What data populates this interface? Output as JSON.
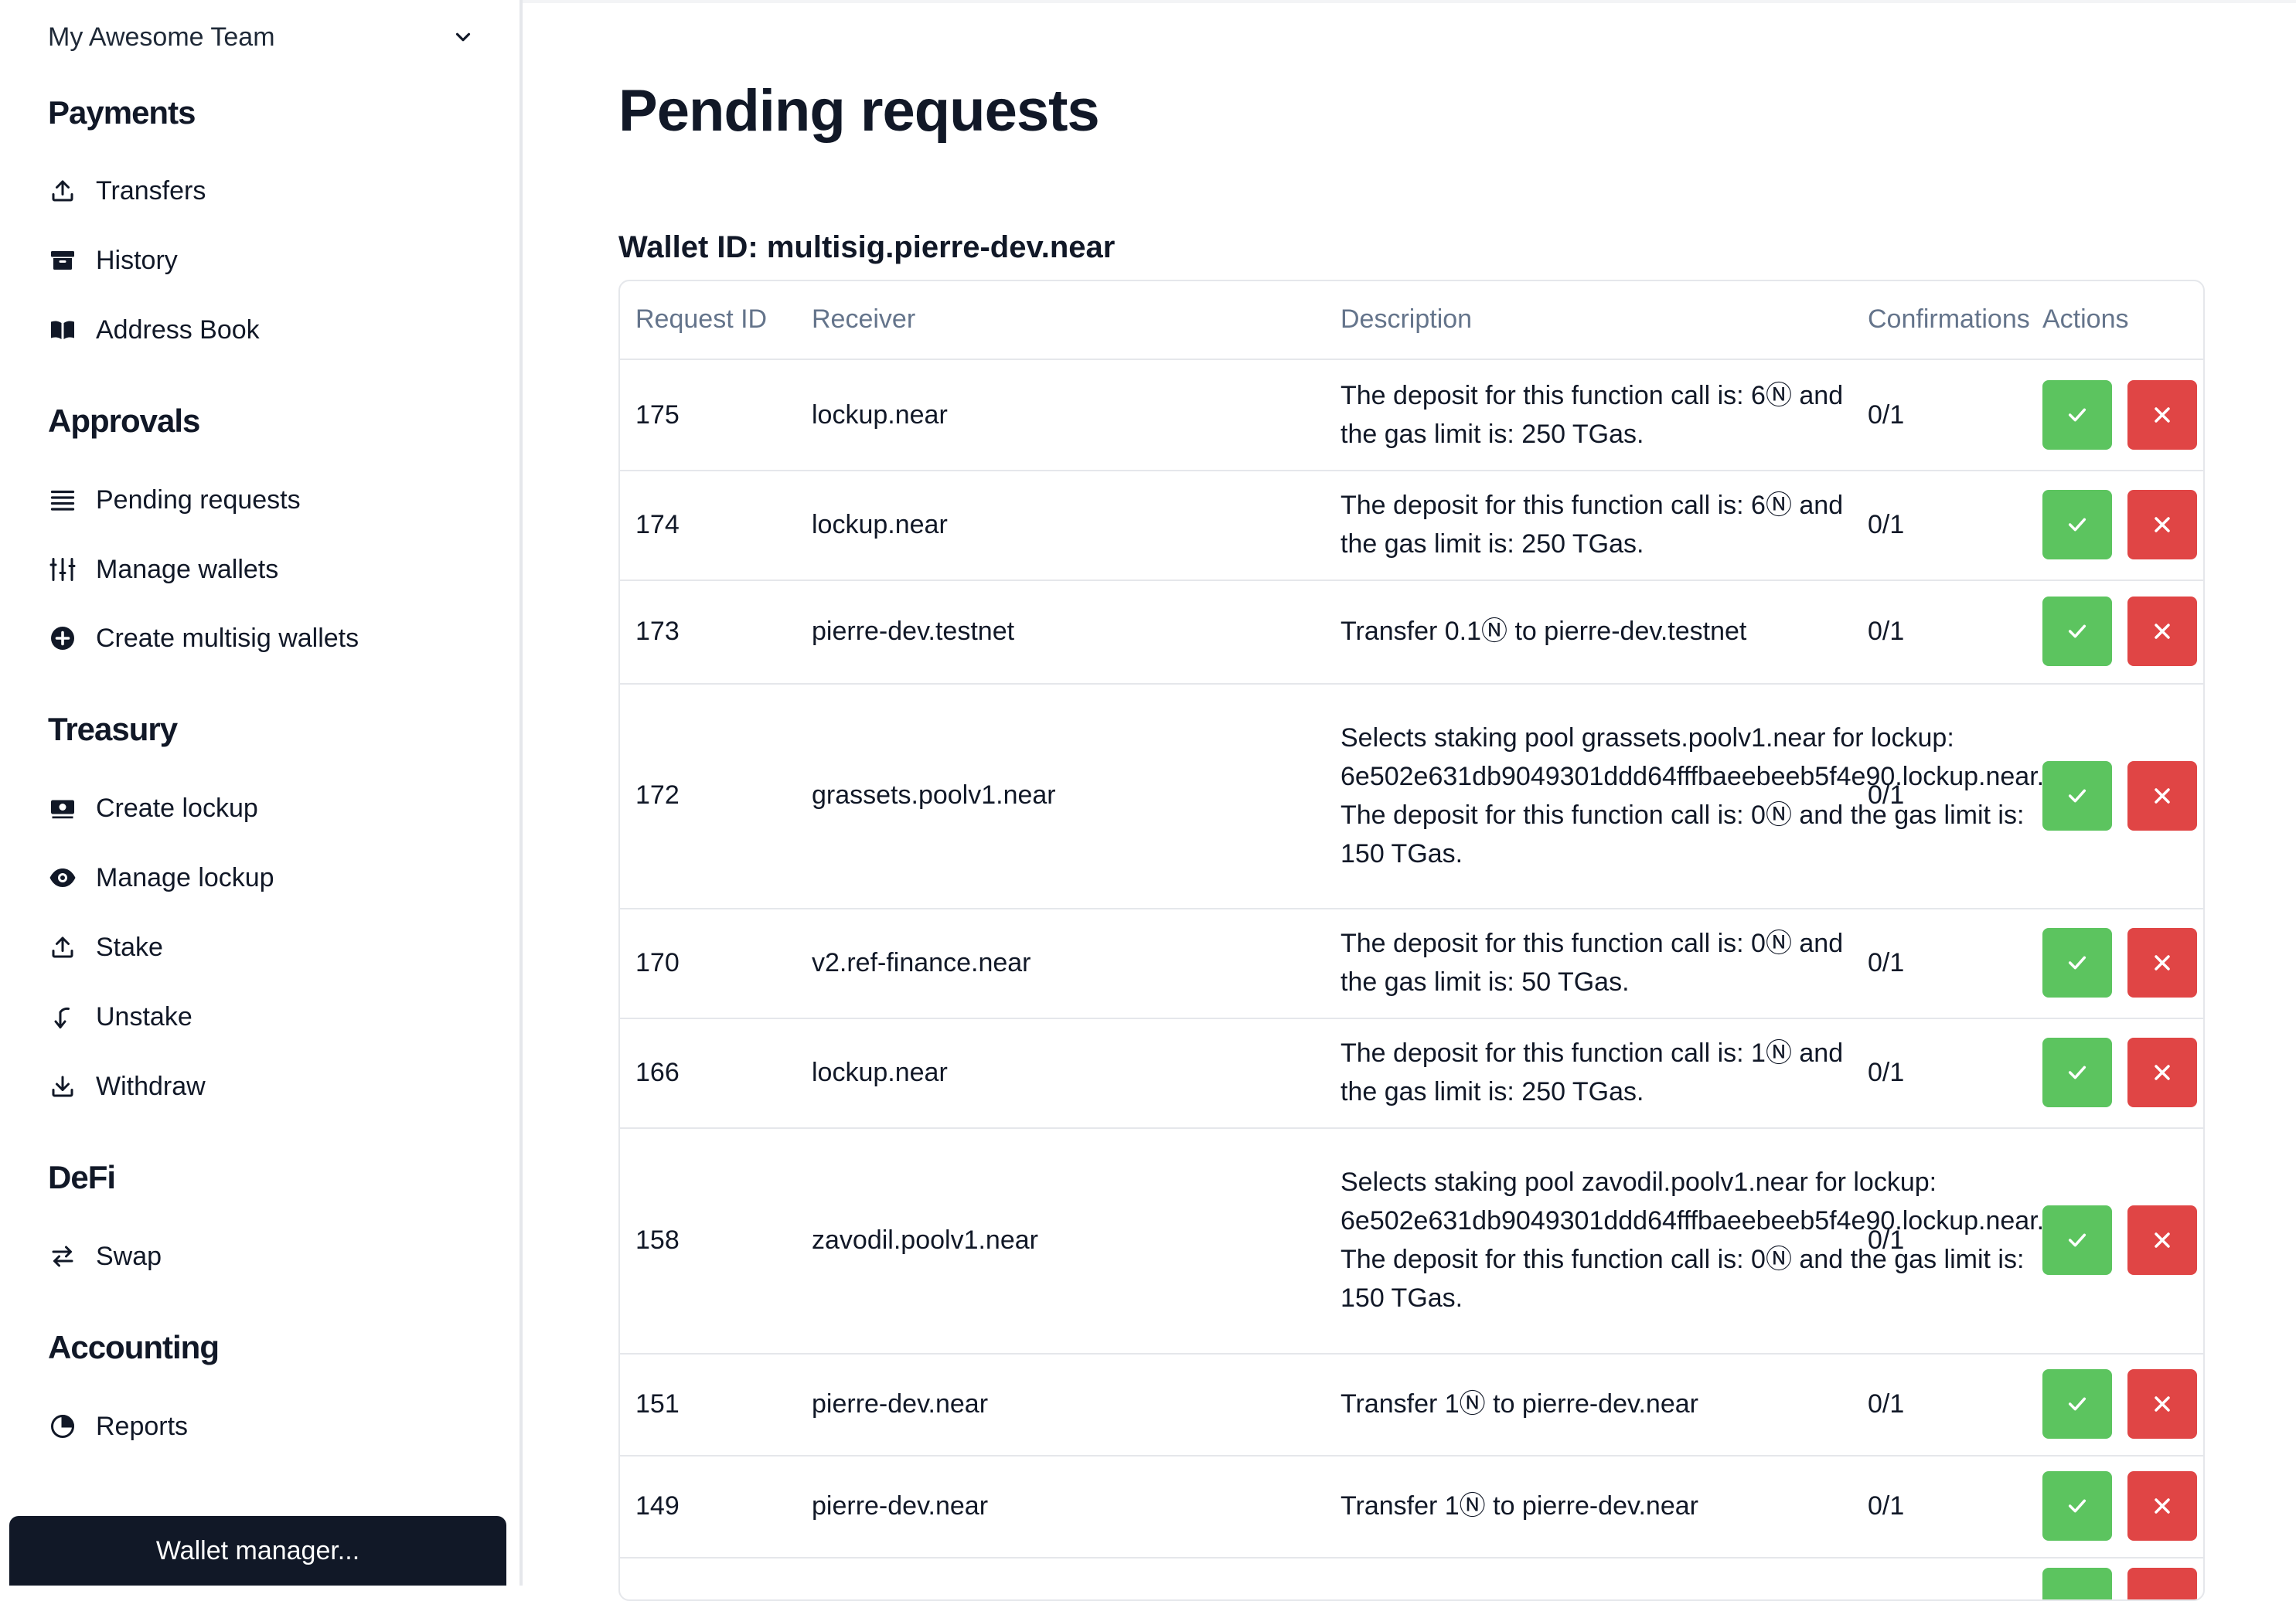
{
  "sidebar": {
    "team": "My Awesome Team",
    "sections": {
      "payments": {
        "title": "Payments",
        "items": [
          {
            "label": "Transfers",
            "icon": "upload-icon"
          },
          {
            "label": "History",
            "icon": "archive-icon"
          },
          {
            "label": "Address Book",
            "icon": "book-icon"
          }
        ]
      },
      "approvals": {
        "title": "Approvals",
        "items": [
          {
            "label": "Pending requests",
            "icon": "list-icon"
          },
          {
            "label": "Manage wallets",
            "icon": "sliders-icon"
          },
          {
            "label": "Create multisig wallets",
            "icon": "plus-circle-icon"
          }
        ]
      },
      "treasury": {
        "title": "Treasury",
        "items": [
          {
            "label": "Create lockup",
            "icon": "cash-icon"
          },
          {
            "label": "Manage lockup",
            "icon": "eye-icon"
          },
          {
            "label": "Stake",
            "icon": "upload-icon"
          },
          {
            "label": "Unstake",
            "icon": "unstake-icon"
          },
          {
            "label": "Withdraw",
            "icon": "download-icon"
          }
        ]
      },
      "defi": {
        "title": "DeFi",
        "items": [
          {
            "label": "Swap",
            "icon": "swap-icon"
          }
        ]
      },
      "accounting": {
        "title": "Accounting",
        "items": [
          {
            "label": "Reports",
            "icon": "pie-chart-icon"
          }
        ]
      }
    },
    "wallet_manager": "Wallet manager..."
  },
  "main": {
    "title": "Pending requests",
    "wallet_id": "Wallet ID: multisig.pierre-dev.near",
    "columns": {
      "request_id": "Request ID",
      "receiver": "Receiver",
      "description": "Description",
      "confirmations": "Confirmations",
      "actions": "Actions"
    },
    "rows": [
      {
        "id": "175",
        "receiver": "lockup.near",
        "description": "The deposit for this function call is: 6Ⓝ and the gas limit is: 250 TGas.",
        "confirmations": "0/1"
      },
      {
        "id": "174",
        "receiver": "lockup.near",
        "description": "The deposit for this function call is: 6Ⓝ and the gas limit is: 250 TGas.",
        "confirmations": "0/1"
      },
      {
        "id": "173",
        "receiver": "pierre-dev.testnet",
        "description": "Transfer 0.1Ⓝ to pierre-dev.testnet",
        "confirmations": "0/1"
      },
      {
        "id": "172",
        "receiver": "grassets.poolv1.near",
        "description": "Selects staking pool grassets.poolv1.near for lockup: 6e502e631db9049301ddd64fffbaeebeeb5f4e90.lockup.near. The deposit for this function call is: 0Ⓝ and the gas limit is: 150 TGas.",
        "confirmations": "0/1"
      },
      {
        "id": "170",
        "receiver": "v2.ref-finance.near",
        "description": "The deposit for this function call is: 0Ⓝ and the gas limit is: 50 TGas.",
        "confirmations": "0/1"
      },
      {
        "id": "166",
        "receiver": "lockup.near",
        "description": "The deposit for this function call is: 1Ⓝ and the gas limit is: 250 TGas.",
        "confirmations": "0/1"
      },
      {
        "id": "158",
        "receiver": "zavodil.poolv1.near",
        "description": "Selects staking pool zavodil.poolv1.near for lockup: 6e502e631db9049301ddd64fffbaeebeeb5f4e90.lockup.near. The deposit for this function call is: 0Ⓝ and the gas limit is: 150 TGas.",
        "confirmations": "0/1"
      },
      {
        "id": "151",
        "receiver": "pierre-dev.near",
        "description": "Transfer 1Ⓝ to pierre-dev.near",
        "confirmations": "0/1"
      },
      {
        "id": "149",
        "receiver": "pierre-dev.near",
        "description": "Transfer 1Ⓝ to pierre-dev.near",
        "confirmations": "0/1"
      }
    ]
  },
  "colors": {
    "approve": "#5cc45f",
    "reject": "#e04545",
    "sidebar_button": "#111827",
    "header_text": "#64748b"
  }
}
